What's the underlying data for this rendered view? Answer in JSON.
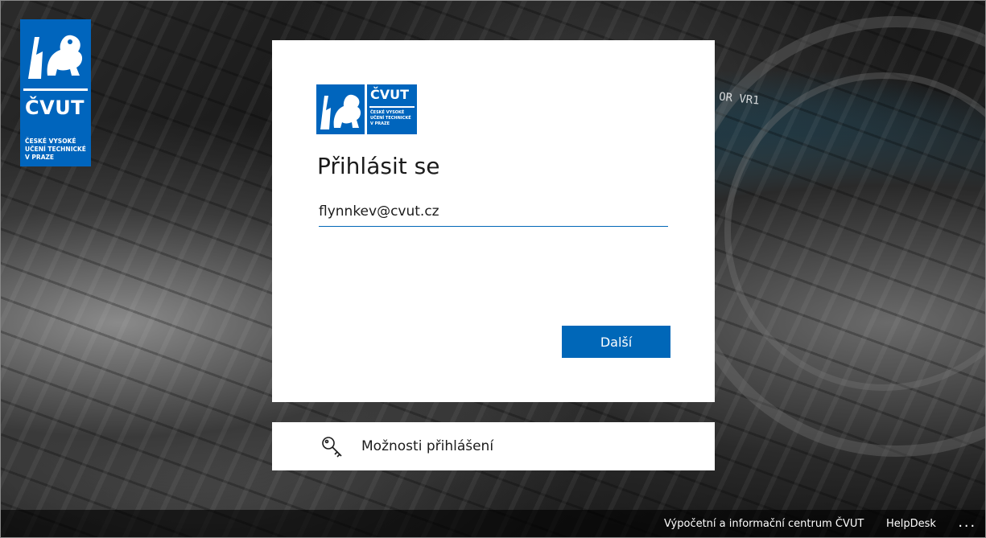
{
  "corner_logo": {
    "wordmark": "ČVUT",
    "subtitle": "ČESKÉ VYSOKÉ\nUČENÍ TECHNICKÉ\nV PRAZE"
  },
  "card": {
    "logo_wordmark": "ČVUT",
    "logo_subtitle": "ČESKÉ VYSOKÉ\nUČENÍ TECHNICKÉ\nV PRAZE",
    "title": "Přihlásit se",
    "email_value": "flynnkev@cvut.cz",
    "next_label": "Další"
  },
  "options": {
    "label": "Možnosti přihlášení",
    "icon": "key-icon"
  },
  "background_text": "OR VR1",
  "footer": {
    "center_link": "Výpočetní a informační centrum ČVUT",
    "helpdesk_link": "HelpDesk",
    "more": "..."
  },
  "colors": {
    "brand_blue": "#0065bd",
    "button_blue": "#0067b8"
  }
}
